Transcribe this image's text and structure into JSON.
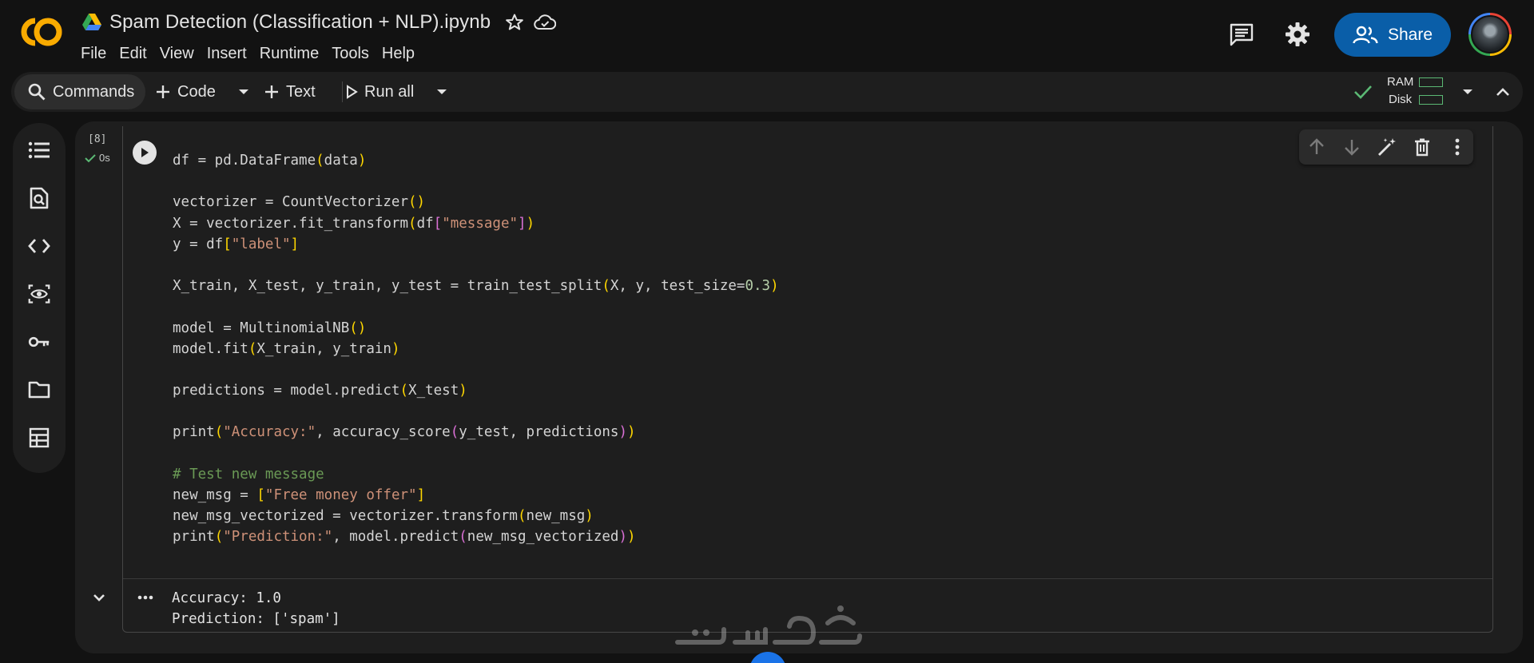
{
  "header": {
    "logo_text": "CO",
    "notebook_title": "Spam Detection (Classification + NLP).ipynb",
    "menu": [
      "File",
      "Edit",
      "View",
      "Insert",
      "Runtime",
      "Tools",
      "Help"
    ],
    "share_label": "Share"
  },
  "toolbar": {
    "commands_label": "Commands",
    "code_label": "Code",
    "text_label": "Text",
    "run_all_label": "Run all",
    "ram_label": "RAM",
    "disk_label": "Disk"
  },
  "sidebar": {
    "items": [
      "table-of-contents-icon",
      "find-replace-icon",
      "code-snippets-icon",
      "variables-icon",
      "secrets-key-icon",
      "files-folder-icon",
      "data-table-icon"
    ]
  },
  "cell": {
    "execution_count": "[8]",
    "exec_time": "0s",
    "output_lines": [
      "Accuracy: 1.0",
      "Prediction: ['spam']"
    ]
  },
  "colors": {
    "accent": "#0a5ea8",
    "background": "#121212",
    "panel": "#1e1e1e",
    "success": "#5bb974"
  }
}
